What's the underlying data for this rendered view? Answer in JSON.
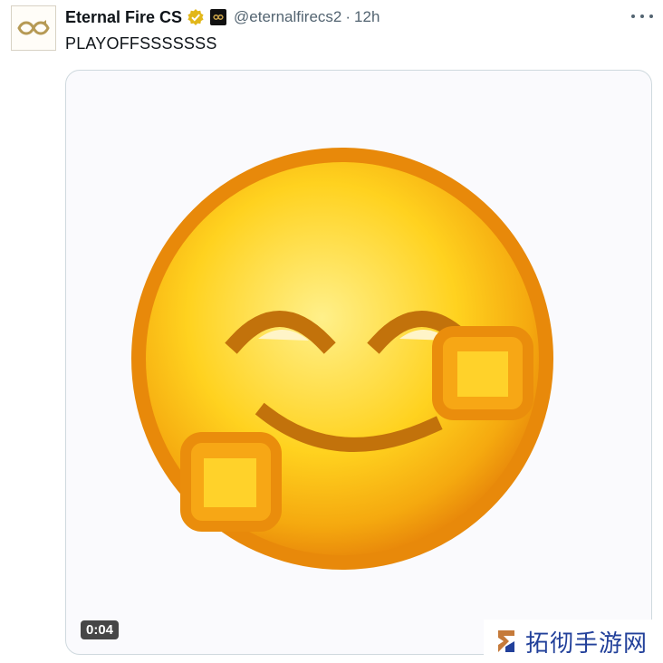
{
  "tweet": {
    "author_name": "Eternal Fire CS",
    "handle": "@eternalfirecs2",
    "separator": "·",
    "time": "12h",
    "text": "PLAYOFFSSSSSSS",
    "verified_color": "#e2b719"
  },
  "media": {
    "type": "video",
    "duration": "0:04",
    "subject": "smiling-face-emoji"
  },
  "watermark": {
    "text": "拓彻手游网",
    "color": "#22409a"
  },
  "icons": {
    "more": "more-dots-icon",
    "verified": "verified-badge-icon",
    "affiliate": "affiliate-badge-icon"
  }
}
